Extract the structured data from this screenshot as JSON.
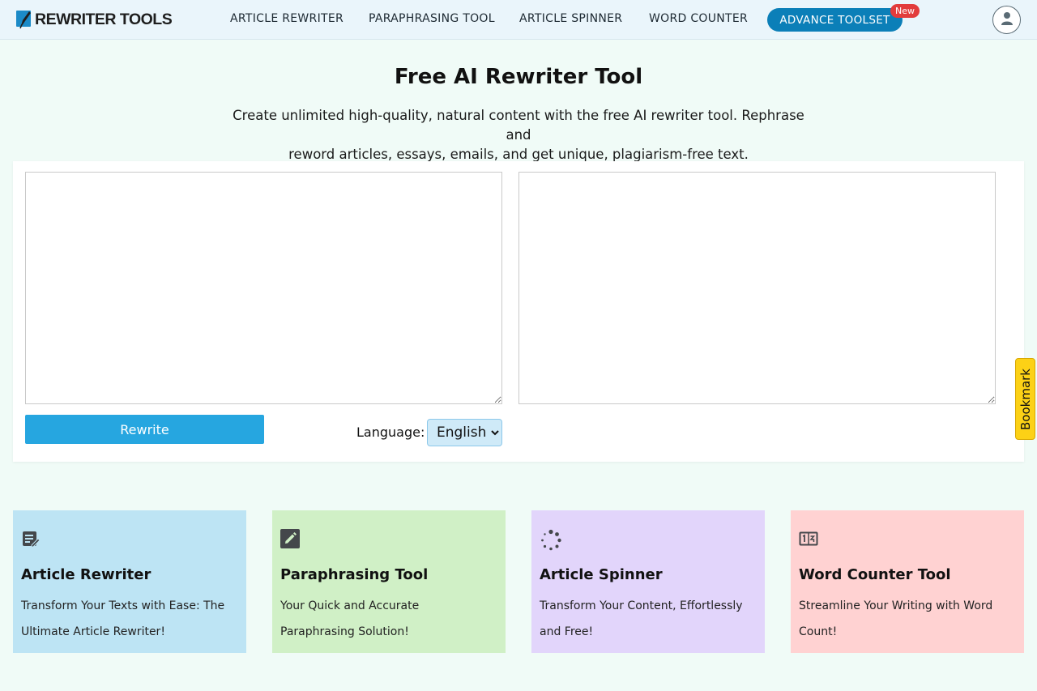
{
  "brand": {
    "logo_text": "REWRITER TOOLS"
  },
  "nav": {
    "items": [
      "ARTICLE REWRITER",
      "PARAPHRASING TOOL",
      "ARTICLE SPINNER",
      "WORD COUNTER"
    ],
    "advance_label": "ADVANCE TOOLSET",
    "new_badge": "New",
    "accent": "#0b7fb8"
  },
  "hero": {
    "title": "Free AI Rewriter Tool",
    "description_line1": "Create unlimited high-quality, natural content with the free AI rewriter tool. Rephrase and",
    "description_line2": "reword articles, essays, emails, and get unique, plagiarism-free text."
  },
  "tool": {
    "input_value": "",
    "output_value": "",
    "rewrite_label": "Rewrite",
    "language_label": "Language:",
    "language_selected": "English"
  },
  "bookmark_label": "Bookmark",
  "cards": [
    {
      "icon": "rewrite-icon",
      "title": "Article Rewriter",
      "line1": "Transform Your Texts with Ease: The",
      "line2": "Ultimate Article Rewriter!",
      "color": "#bde4f4"
    },
    {
      "icon": "edit-icon",
      "title": "Paraphrasing Tool",
      "line1": "Your Quick and Accurate",
      "line2": "Paraphrasing Solution!",
      "color": "#d0f0c6"
    },
    {
      "icon": "spinner-icon",
      "title": "Article Spinner",
      "line1": "Transform Your Content, Effortlessly",
      "line2": "and Free!",
      "color": "#e2d5fb"
    },
    {
      "icon": "counter-icon",
      "title": "Word Counter Tool",
      "line1": "Streamline Your Writing with Word",
      "line2": "Count!",
      "color": "#ffd2d2"
    }
  ]
}
